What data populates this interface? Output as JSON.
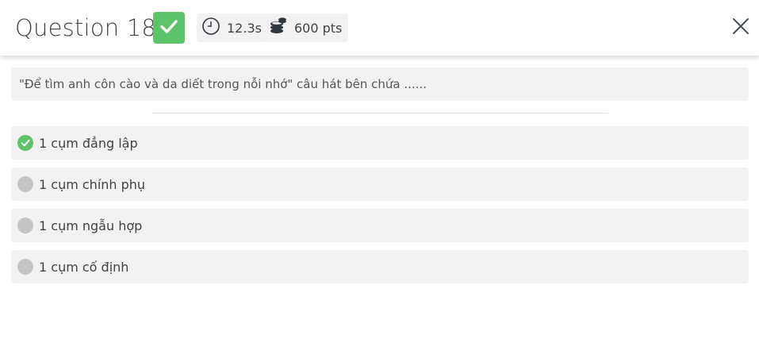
{
  "header": {
    "title": "Question 18",
    "status_icon": "check-icon",
    "time": "12.3s",
    "time_icon": "clock-icon",
    "points": "600 pts",
    "points_icon": "coins-icon",
    "close_icon": "close-icon"
  },
  "question": {
    "text": "\"Để tìm anh côn cào và da diết trong nỗi nhớ\" câu hát bên chứa ......"
  },
  "options": [
    {
      "label": "1 cụm đẳng lập",
      "state": "correct"
    },
    {
      "label": "1 cụm chính phụ",
      "state": "unselected"
    },
    {
      "label": "1 cụm ngẫu hợp",
      "state": "unselected"
    },
    {
      "label": "1 cụm cố định",
      "state": "unselected"
    }
  ],
  "colors": {
    "correct": "#5dc46b",
    "unselected": "#c4c4c4",
    "panel": "#f2f2f2",
    "text": "#424242"
  }
}
